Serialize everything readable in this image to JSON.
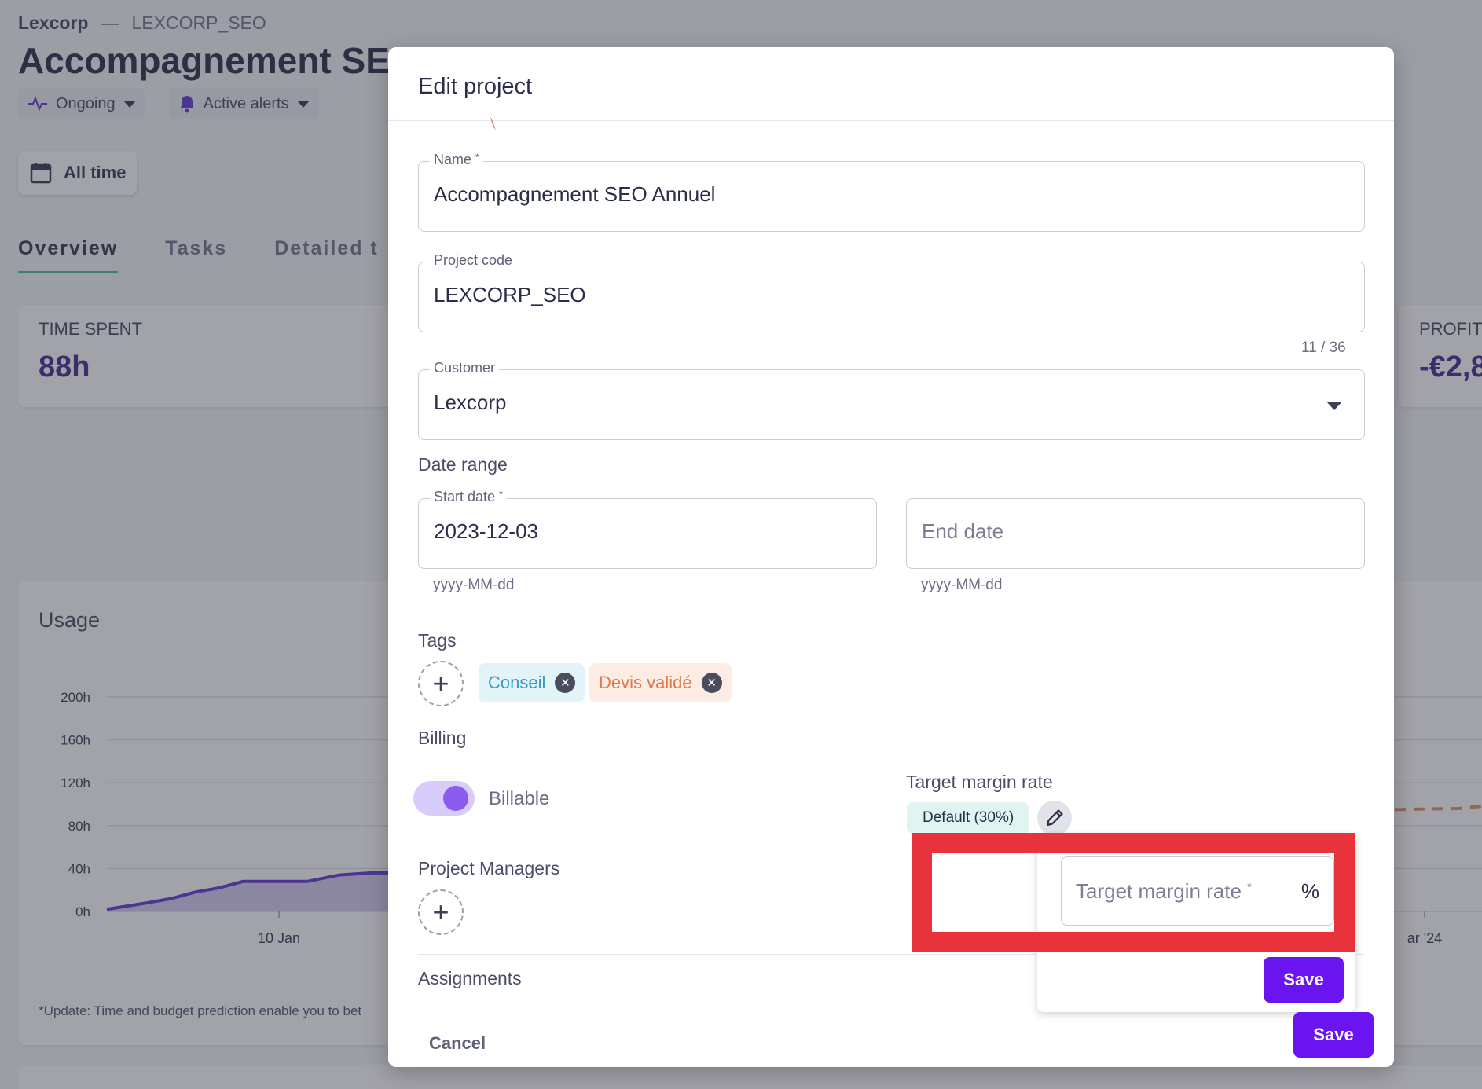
{
  "background": {
    "breadcrumb": {
      "customer": "Lexcorp",
      "separator": "—",
      "code": "LEXCORP_SEO"
    },
    "title": "Accompagnement SEO",
    "status": {
      "label": "Ongoing",
      "icon": "activity-icon"
    },
    "alerts": {
      "label": "Active alerts",
      "icon": "bell-icon"
    },
    "period_button": "All time",
    "tabs": [
      "Overview",
      "Tasks",
      "Detailed t"
    ],
    "time_spent": {
      "label": "TIME SPENT",
      "value": "88h"
    },
    "profit": {
      "label": "PROFIT",
      "value": "-€2,8"
    },
    "usage": {
      "title": "Usage",
      "footnote": "*Update: Time and budget prediction enable you to bet"
    }
  },
  "chart_data": {
    "type": "area",
    "title": "Usage",
    "y_ticks": [
      "200h",
      "160h",
      "120h",
      "80h",
      "40h",
      "0h"
    ],
    "ylim": [
      0,
      200
    ],
    "x_tick_labels": [
      "10 Jan",
      "ar '24"
    ],
    "series": [
      {
        "name": "",
        "color": "#5b2bd6",
        "points": [
          [
            0,
            2
          ],
          [
            5,
            8
          ],
          [
            8,
            12
          ],
          [
            11,
            18
          ],
          [
            14,
            22
          ],
          [
            17,
            28
          ],
          [
            25,
            28
          ],
          [
            29,
            34
          ],
          [
            33,
            36
          ],
          [
            38,
            36
          ]
        ]
      },
      {
        "name": "",
        "color": "#d88c6a",
        "dashed": true,
        "points": [
          [
            0,
            95
          ],
          [
            4,
            96
          ],
          [
            7,
            100
          ]
        ]
      }
    ]
  },
  "modal": {
    "title": "Edit project",
    "name_field": {
      "label": "Name",
      "required": "*",
      "value": "Accompagnement SEO Annuel"
    },
    "code_field": {
      "label": "Project code",
      "value": "LEXCORP_SEO",
      "counter": "11 / 36"
    },
    "customer_field": {
      "label": "Customer",
      "value": "Lexcorp"
    },
    "date_range": {
      "label": "Date range",
      "start": {
        "label": "Start date",
        "required": "*",
        "value": "2023-12-03",
        "hint": "yyyy-MM-dd"
      },
      "end": {
        "placeholder": "End date",
        "hint": "yyyy-MM-dd"
      }
    },
    "tags": {
      "label": "Tags",
      "items": [
        {
          "label": "Conseil",
          "bg": "#e3f4f9",
          "color": "#3a9cc2"
        },
        {
          "label": "Devis validé",
          "bg": "#fdece4",
          "color": "#e07a4e"
        }
      ]
    },
    "billing": {
      "label": "Billing",
      "toggle_label": "Billable",
      "enabled": true
    },
    "target_margin": {
      "label": "Target margin rate",
      "default_badge": "Default (30%)",
      "input_placeholder": "Target margin rate",
      "required": "*",
      "unit": "%",
      "save_label": "Save"
    },
    "project_managers": {
      "label": "Project Managers"
    },
    "assignments": {
      "label": "Assignments"
    },
    "cancel_label": "Cancel",
    "save_label": "Save",
    "highlight_color": "#e8323c"
  }
}
